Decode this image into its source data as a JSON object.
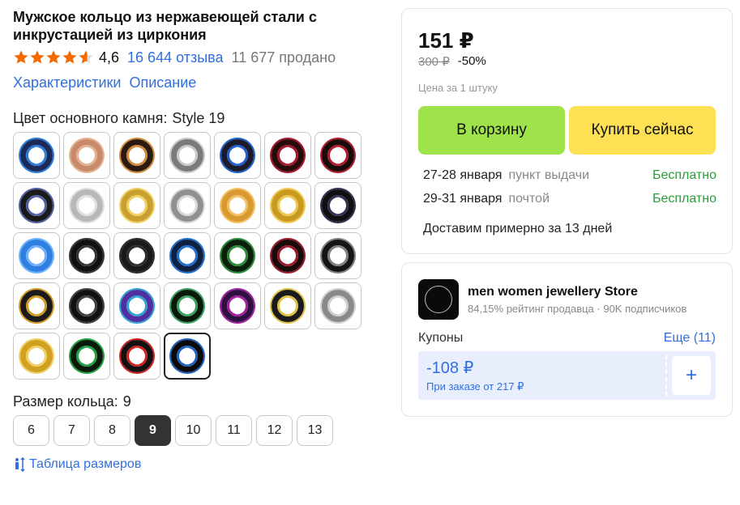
{
  "product": {
    "title": "Мужское кольцо из нержавеющей стали с инкрустацией из циркония",
    "rating": "4,6",
    "rating_stars_value": 4.6,
    "reviews": "16 644 отзыва",
    "sold": "11 677 продано",
    "tabs": [
      "Характеристики",
      "Описание"
    ]
  },
  "color": {
    "label": "Цвет основного камня:",
    "value": "Style 19",
    "selected_index": 31,
    "swatch_colors": [
      [
        "#1c2a5a",
        "#2b7bd8"
      ],
      [
        "#c98a6a",
        "#e3b190"
      ],
      [
        "#2a1a10",
        "#d08a3a"
      ],
      [
        "#7a7a7a",
        "#c9c9c9"
      ],
      [
        "#1b1b2b",
        "#1e5fd0"
      ],
      [
        "#2a0a0a",
        "#a4162a"
      ],
      [
        "#1a0a0a",
        "#b01a2a"
      ],
      [
        "#1a1a1a",
        "#5060a0"
      ],
      [
        "#b8b8b8",
        "#e0e0e0"
      ],
      [
        "#c9a030",
        "#f0d060"
      ],
      [
        "#909090",
        "#d8d8d8"
      ],
      [
        "#d89a30",
        "#f2c060"
      ],
      [
        "#c99a20",
        "#f0c850"
      ],
      [
        "#101010",
        "#303050"
      ],
      [
        "#2f7fe0",
        "#6ab0ff"
      ],
      [
        "#111111",
        "#333333"
      ],
      [
        "#1a1a1a",
        "#2a2a2a"
      ],
      [
        "#102040",
        "#1f6fd0"
      ],
      [
        "#0a200a",
        "#2a8a3a"
      ],
      [
        "#1a0a0a",
        "#9a1a2a"
      ],
      [
        "#151515",
        "#808080"
      ],
      [
        "#1a1a1a",
        "#d09a20"
      ],
      [
        "#111111",
        "#404040"
      ],
      [
        "#5030a0",
        "#30a0d0"
      ],
      [
        "#0a1a0a",
        "#3aa060"
      ],
      [
        "#301040",
        "#a020a0"
      ],
      [
        "#1a1a1a",
        "#e0c040"
      ],
      [
        "#8a8a8a",
        "#d0d0d0"
      ],
      [
        "#d0a020",
        "#f0d060"
      ],
      [
        "#0a1a0a",
        "#20a040"
      ],
      [
        "#111111",
        "#d02020"
      ],
      [
        "#0a0a0a",
        "#2060c0"
      ]
    ]
  },
  "size": {
    "label": "Размер кольца:",
    "value": "9",
    "options": [
      "6",
      "7",
      "8",
      "9",
      "10",
      "11",
      "12",
      "13"
    ],
    "selected": "9",
    "table_link": "Таблица размеров"
  },
  "price": {
    "current": "151 ₽",
    "old": "300 ₽",
    "discount": "-50%",
    "per_unit": "Цена за 1 штуку",
    "cart_button": "В корзину",
    "buy_button": "Купить сейчас",
    "delivery": [
      {
        "date": "27-28 января",
        "method": "пункт выдачи",
        "cost": "Бесплатно"
      },
      {
        "date": "29-31 января",
        "method": "почтой",
        "cost": "Бесплатно"
      }
    ],
    "approx": "Доставим примерно за 13 дней",
    "free_color": "#2a9d3a"
  },
  "store": {
    "name": "men women jewellery Store",
    "meta": "84,15% рейтинг продавца · 90K подписчиков",
    "coupons_label": "Купоны",
    "coupons_more": "Еще (11)",
    "coupon_amount": "-108 ₽",
    "coupon_condition": "При заказе от 217 ₽",
    "add_icon": "plus-icon"
  },
  "colors": {
    "accent": "#2f6fe0",
    "cart_green": "#9fe34a",
    "buy_yellow": "#fde054",
    "star_orange": "#f56a00"
  }
}
